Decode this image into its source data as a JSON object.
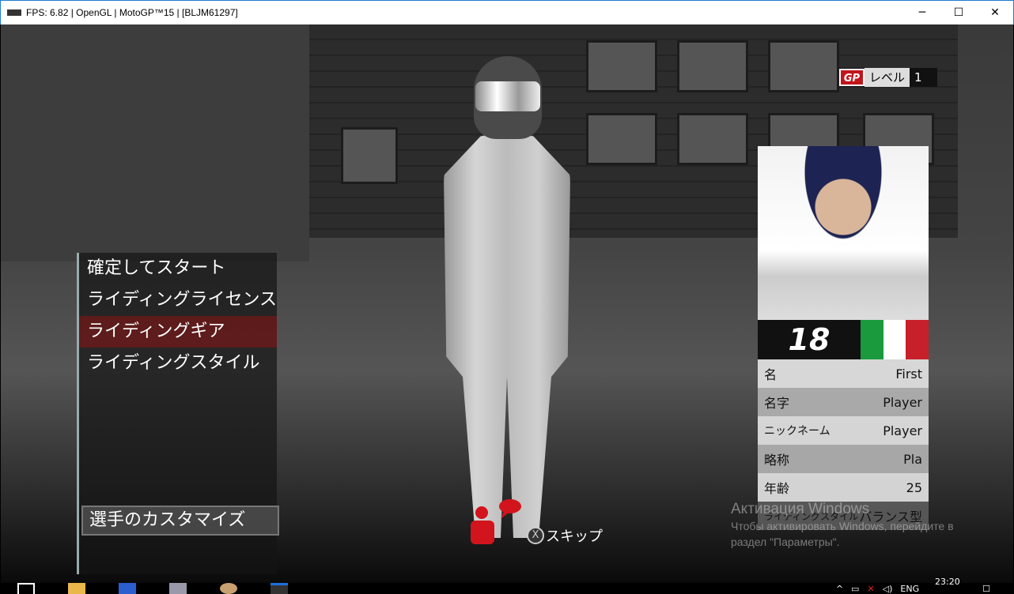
{
  "window": {
    "title": "FPS: 6.82 | OpenGL | MotoGP™15 | [BLJM61297]",
    "minimize": "─",
    "maximize": "☐",
    "close": "✕"
  },
  "level": {
    "badge": "GP",
    "label": "レベル",
    "value": "1"
  },
  "menu": {
    "items": [
      "確定してスタート",
      "ライディングライセンス",
      "ライディングギア",
      "ライディングスタイル"
    ],
    "section": "選手のカスタマイズ"
  },
  "rider": {
    "number": "18",
    "flag_colors": [
      "#1a9a3c",
      "#ffffff",
      "#c8202a"
    ],
    "fields": [
      {
        "label": "名",
        "value": "First"
      },
      {
        "label": "名字",
        "value": "Player"
      },
      {
        "label": "ニックネーム",
        "value": "Player"
      },
      {
        "label": "略称",
        "value": "Pla"
      },
      {
        "label": "年齢",
        "value": "25"
      },
      {
        "label": "ライディングスタイル",
        "value": "バランス型"
      }
    ]
  },
  "prompt": {
    "button": "X",
    "label": "スキップ"
  },
  "activation": {
    "heading": "Активация Windows",
    "line1": "Чтобы активировать Windows, перейдите в",
    "line2": "раздел \"Параметры\"."
  },
  "taskbar": {
    "lang": "ENG",
    "time": "23:20"
  }
}
